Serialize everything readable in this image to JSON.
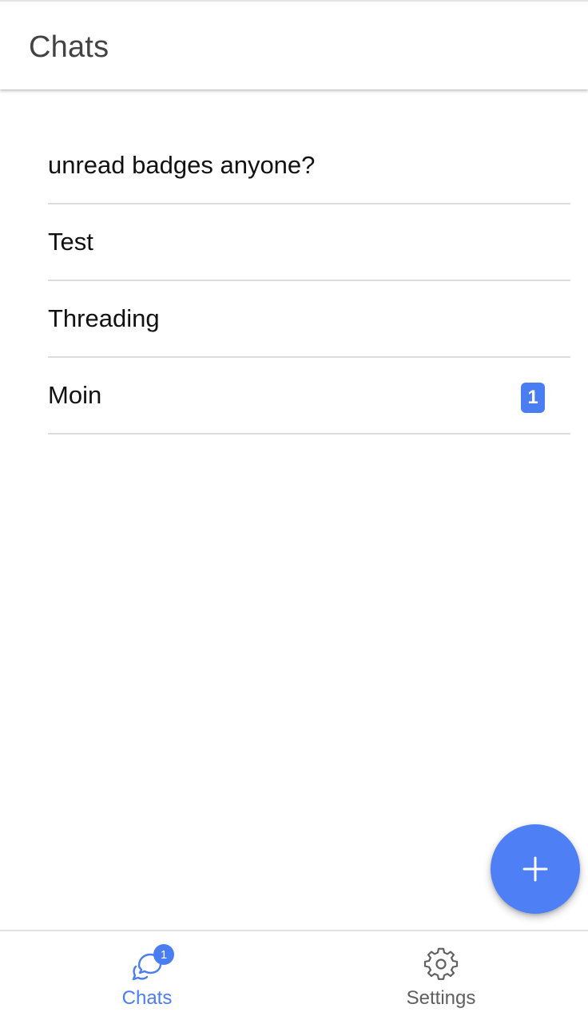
{
  "header": {
    "title": "Chats"
  },
  "chats": [
    {
      "name": "unread badges anyone?",
      "unread": ""
    },
    {
      "name": "Test",
      "unread": ""
    },
    {
      "name": "Threading",
      "unread": ""
    },
    {
      "name": "Moin",
      "unread": "1"
    }
  ],
  "fab": {
    "icon": "plus-icon"
  },
  "tabbar": {
    "tabs": [
      {
        "label": "Chats",
        "icon": "chat-bubbles-icon",
        "badge": "1",
        "active": true
      },
      {
        "label": "Settings",
        "icon": "gear-icon",
        "active": false
      }
    ]
  },
  "colors": {
    "accent": "#4a7cf2",
    "fab": "#4e7ff5",
    "header_title": "#424242",
    "inactive_tab": "#5f5f5f",
    "divider": "#dcdcdc"
  }
}
